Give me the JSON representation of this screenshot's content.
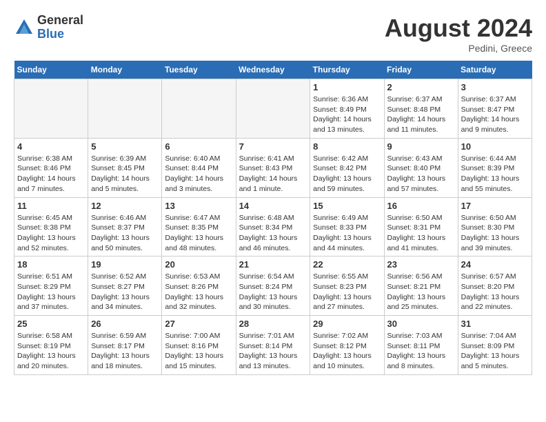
{
  "header": {
    "logo_general": "General",
    "logo_blue": "Blue",
    "month_year": "August 2024",
    "location": "Pedini, Greece"
  },
  "days_of_week": [
    "Sunday",
    "Monday",
    "Tuesday",
    "Wednesday",
    "Thursday",
    "Friday",
    "Saturday"
  ],
  "weeks": [
    [
      {
        "day": "",
        "info": "",
        "empty": true
      },
      {
        "day": "",
        "info": "",
        "empty": true
      },
      {
        "day": "",
        "info": "",
        "empty": true
      },
      {
        "day": "",
        "info": "",
        "empty": true
      },
      {
        "day": "1",
        "info": "Sunrise: 6:36 AM\nSunset: 8:49 PM\nDaylight: 14 hours\nand 13 minutes.",
        "empty": false
      },
      {
        "day": "2",
        "info": "Sunrise: 6:37 AM\nSunset: 8:48 PM\nDaylight: 14 hours\nand 11 minutes.",
        "empty": false
      },
      {
        "day": "3",
        "info": "Sunrise: 6:37 AM\nSunset: 8:47 PM\nDaylight: 14 hours\nand 9 minutes.",
        "empty": false
      }
    ],
    [
      {
        "day": "4",
        "info": "Sunrise: 6:38 AM\nSunset: 8:46 PM\nDaylight: 14 hours\nand 7 minutes.",
        "empty": false
      },
      {
        "day": "5",
        "info": "Sunrise: 6:39 AM\nSunset: 8:45 PM\nDaylight: 14 hours\nand 5 minutes.",
        "empty": false
      },
      {
        "day": "6",
        "info": "Sunrise: 6:40 AM\nSunset: 8:44 PM\nDaylight: 14 hours\nand 3 minutes.",
        "empty": false
      },
      {
        "day": "7",
        "info": "Sunrise: 6:41 AM\nSunset: 8:43 PM\nDaylight: 14 hours\nand 1 minute.",
        "empty": false
      },
      {
        "day": "8",
        "info": "Sunrise: 6:42 AM\nSunset: 8:42 PM\nDaylight: 13 hours\nand 59 minutes.",
        "empty": false
      },
      {
        "day": "9",
        "info": "Sunrise: 6:43 AM\nSunset: 8:40 PM\nDaylight: 13 hours\nand 57 minutes.",
        "empty": false
      },
      {
        "day": "10",
        "info": "Sunrise: 6:44 AM\nSunset: 8:39 PM\nDaylight: 13 hours\nand 55 minutes.",
        "empty": false
      }
    ],
    [
      {
        "day": "11",
        "info": "Sunrise: 6:45 AM\nSunset: 8:38 PM\nDaylight: 13 hours\nand 52 minutes.",
        "empty": false
      },
      {
        "day": "12",
        "info": "Sunrise: 6:46 AM\nSunset: 8:37 PM\nDaylight: 13 hours\nand 50 minutes.",
        "empty": false
      },
      {
        "day": "13",
        "info": "Sunrise: 6:47 AM\nSunset: 8:35 PM\nDaylight: 13 hours\nand 48 minutes.",
        "empty": false
      },
      {
        "day": "14",
        "info": "Sunrise: 6:48 AM\nSunset: 8:34 PM\nDaylight: 13 hours\nand 46 minutes.",
        "empty": false
      },
      {
        "day": "15",
        "info": "Sunrise: 6:49 AM\nSunset: 8:33 PM\nDaylight: 13 hours\nand 44 minutes.",
        "empty": false
      },
      {
        "day": "16",
        "info": "Sunrise: 6:50 AM\nSunset: 8:31 PM\nDaylight: 13 hours\nand 41 minutes.",
        "empty": false
      },
      {
        "day": "17",
        "info": "Sunrise: 6:50 AM\nSunset: 8:30 PM\nDaylight: 13 hours\nand 39 minutes.",
        "empty": false
      }
    ],
    [
      {
        "day": "18",
        "info": "Sunrise: 6:51 AM\nSunset: 8:29 PM\nDaylight: 13 hours\nand 37 minutes.",
        "empty": false
      },
      {
        "day": "19",
        "info": "Sunrise: 6:52 AM\nSunset: 8:27 PM\nDaylight: 13 hours\nand 34 minutes.",
        "empty": false
      },
      {
        "day": "20",
        "info": "Sunrise: 6:53 AM\nSunset: 8:26 PM\nDaylight: 13 hours\nand 32 minutes.",
        "empty": false
      },
      {
        "day": "21",
        "info": "Sunrise: 6:54 AM\nSunset: 8:24 PM\nDaylight: 13 hours\nand 30 minutes.",
        "empty": false
      },
      {
        "day": "22",
        "info": "Sunrise: 6:55 AM\nSunset: 8:23 PM\nDaylight: 13 hours\nand 27 minutes.",
        "empty": false
      },
      {
        "day": "23",
        "info": "Sunrise: 6:56 AM\nSunset: 8:21 PM\nDaylight: 13 hours\nand 25 minutes.",
        "empty": false
      },
      {
        "day": "24",
        "info": "Sunrise: 6:57 AM\nSunset: 8:20 PM\nDaylight: 13 hours\nand 22 minutes.",
        "empty": false
      }
    ],
    [
      {
        "day": "25",
        "info": "Sunrise: 6:58 AM\nSunset: 8:19 PM\nDaylight: 13 hours\nand 20 minutes.",
        "empty": false
      },
      {
        "day": "26",
        "info": "Sunrise: 6:59 AM\nSunset: 8:17 PM\nDaylight: 13 hours\nand 18 minutes.",
        "empty": false
      },
      {
        "day": "27",
        "info": "Sunrise: 7:00 AM\nSunset: 8:16 PM\nDaylight: 13 hours\nand 15 minutes.",
        "empty": false
      },
      {
        "day": "28",
        "info": "Sunrise: 7:01 AM\nSunset: 8:14 PM\nDaylight: 13 hours\nand 13 minutes.",
        "empty": false
      },
      {
        "day": "29",
        "info": "Sunrise: 7:02 AM\nSunset: 8:12 PM\nDaylight: 13 hours\nand 10 minutes.",
        "empty": false
      },
      {
        "day": "30",
        "info": "Sunrise: 7:03 AM\nSunset: 8:11 PM\nDaylight: 13 hours\nand 8 minutes.",
        "empty": false
      },
      {
        "day": "31",
        "info": "Sunrise: 7:04 AM\nSunset: 8:09 PM\nDaylight: 13 hours\nand 5 minutes.",
        "empty": false
      }
    ]
  ]
}
